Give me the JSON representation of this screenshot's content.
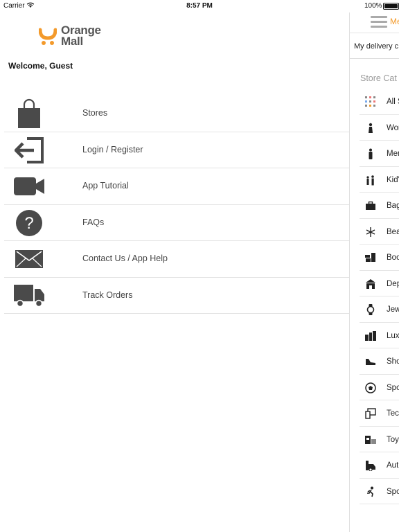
{
  "status_bar": {
    "carrier": "Carrier",
    "time": "8:57 PM",
    "battery": "100%"
  },
  "drawer": {
    "logo_line1": "Orange",
    "logo_line2": "Mall",
    "welcome": "Welcome, Guest",
    "items": [
      {
        "label": "Stores",
        "icon": "shopping-bag-icon"
      },
      {
        "label": "Login / Register",
        "icon": "login-icon"
      },
      {
        "label": "App Tutorial",
        "icon": "video-camera-icon"
      },
      {
        "label": "FAQs",
        "icon": "question-icon"
      },
      {
        "label": "Contact Us / App Help",
        "icon": "envelope-icon"
      },
      {
        "label": "Track Orders",
        "icon": "truck-icon"
      }
    ]
  },
  "main": {
    "menu_label": "Me",
    "delivery_text": "My delivery c",
    "section_title": "Store Cat",
    "categories": [
      {
        "label": "All S",
        "icon": "grid-icon"
      },
      {
        "label": "Wor",
        "icon": "woman-icon"
      },
      {
        "label": "Mer",
        "icon": "man-icon"
      },
      {
        "label": "Kid'",
        "icon": "kids-icon"
      },
      {
        "label": "Bag",
        "icon": "bag-icon"
      },
      {
        "label": "Bea",
        "icon": "beauty-icon"
      },
      {
        "label": "Boo",
        "icon": "books-icon"
      },
      {
        "label": "Dep",
        "icon": "department-store-icon"
      },
      {
        "label": "Jew",
        "icon": "watch-icon"
      },
      {
        "label": "Lux",
        "icon": "luxury-icon"
      },
      {
        "label": "Sho",
        "icon": "shoe-icon"
      },
      {
        "label": "Spo",
        "icon": "soccer-ball-icon"
      },
      {
        "label": "Tec",
        "icon": "tech-icon"
      },
      {
        "label": "Toy",
        "icon": "toys-icon"
      },
      {
        "label": "Aut",
        "icon": "auto-icon"
      },
      {
        "label": "Spo",
        "icon": "sports-runner-icon"
      }
    ]
  },
  "colors": {
    "accent": "#f39a2b",
    "icon": "#4a4a4a",
    "divider": "#e3e3e3"
  }
}
